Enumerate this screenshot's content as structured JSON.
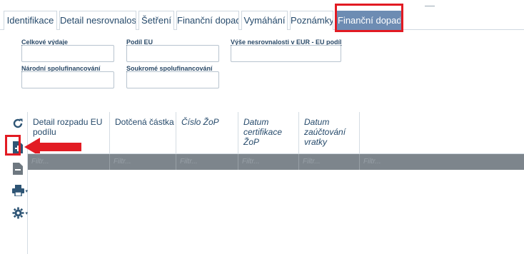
{
  "tabs": [
    {
      "label": "Identifikace",
      "active": false
    },
    {
      "label": "Detail nesrovnalosti",
      "active": false
    },
    {
      "label": "Šetření",
      "active": false
    },
    {
      "label": "Finanční dopad",
      "active": false
    },
    {
      "label": "Vymáhání",
      "active": false
    },
    {
      "label": "Poznámky",
      "active": false
    },
    {
      "label": "Finanční dopad",
      "active": true
    }
  ],
  "form": {
    "celkove_vydaje": {
      "label": "Celkové výdaje",
      "value": ""
    },
    "podil_eu": {
      "label": "Podíl EU",
      "value": ""
    },
    "vyse_nesrovnalosti": {
      "label": "Výše nesrovnalosti v EUR - EU podíl",
      "value": ""
    },
    "narodni": {
      "label": "Národní spolufinancování",
      "value": ""
    },
    "soukrome": {
      "label": "Soukromé spolufinancování",
      "value": ""
    }
  },
  "toolbar": {
    "icons": [
      "refresh-icon",
      "add-record-icon",
      "remove-record-icon",
      "print-icon",
      "settings-icon"
    ]
  },
  "grid": {
    "columns": [
      {
        "label": "Detail rozpadu EU podílu",
        "italic": false
      },
      {
        "label": "Dotčená částka",
        "italic": false
      },
      {
        "label": "Číslo ŽoP",
        "italic": true
      },
      {
        "label": "Datum certifikace ŽoP",
        "italic": true
      },
      {
        "label": "Datum zaúčtování vratky",
        "italic": true
      },
      {
        "label": "",
        "italic": false
      }
    ],
    "filter_placeholder": "Filtr..."
  },
  "colors": {
    "active_tab": "#6d8cb3",
    "highlight": "#e21b23",
    "filter_row": "#7d858c"
  }
}
